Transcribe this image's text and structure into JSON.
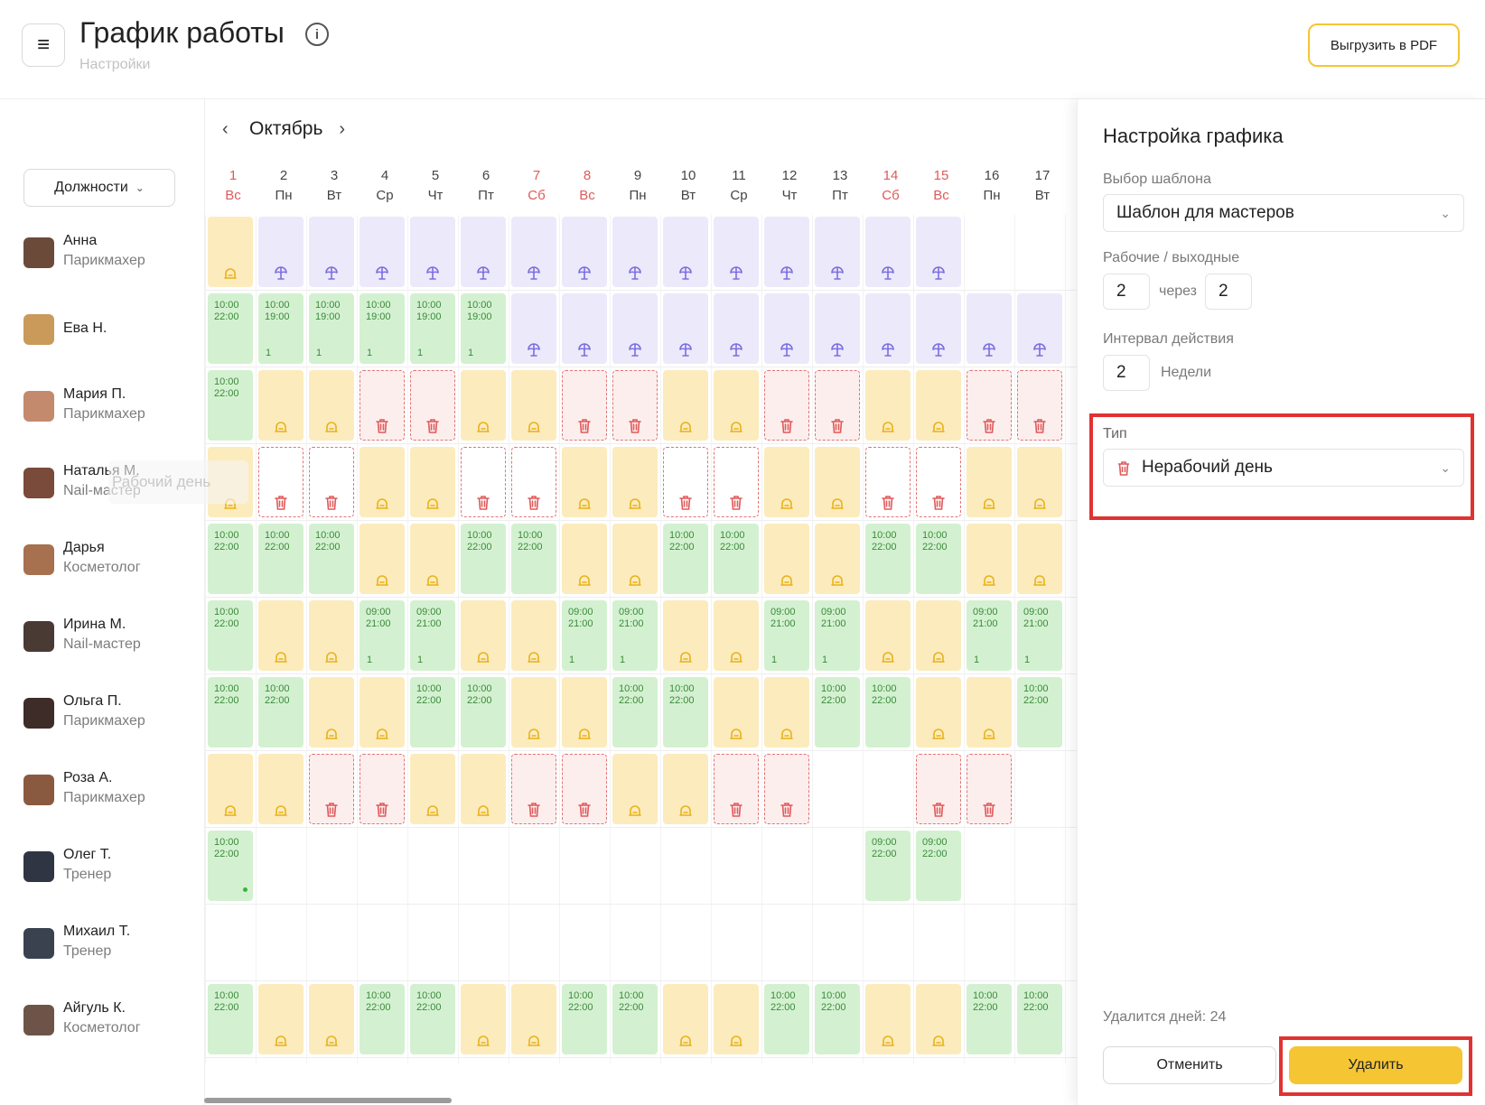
{
  "header": {
    "title": "График работы",
    "subtitle": "Настройки",
    "pdf_button": "Выгрузить в PDF"
  },
  "filters": {
    "positions_label": "Должности"
  },
  "calendar": {
    "month": "Октябрь",
    "days": [
      {
        "num": "1",
        "dow": "Вс",
        "weekend": true
      },
      {
        "num": "2",
        "dow": "Пн",
        "weekend": false
      },
      {
        "num": "3",
        "dow": "Вт",
        "weekend": false
      },
      {
        "num": "4",
        "dow": "Ср",
        "weekend": false
      },
      {
        "num": "5",
        "dow": "Чт",
        "weekend": false
      },
      {
        "num": "6",
        "dow": "Пт",
        "weekend": false
      },
      {
        "num": "7",
        "dow": "Сб",
        "weekend": true
      },
      {
        "num": "8",
        "dow": "Вс",
        "weekend": true
      },
      {
        "num": "9",
        "dow": "Пн",
        "weekend": false
      },
      {
        "num": "10",
        "dow": "Вт",
        "weekend": false
      },
      {
        "num": "11",
        "dow": "Ср",
        "weekend": false
      },
      {
        "num": "12",
        "dow": "Чт",
        "weekend": false
      },
      {
        "num": "13",
        "dow": "Пт",
        "weekend": false
      },
      {
        "num": "14",
        "dow": "Сб",
        "weekend": true
      },
      {
        "num": "15",
        "dow": "Вс",
        "weekend": true
      },
      {
        "num": "16",
        "dow": "Пн",
        "weekend": false
      },
      {
        "num": "17",
        "dow": "Вт",
        "weekend": false
      }
    ],
    "ghost_label": "Рабочий день"
  },
  "employees": [
    {
      "name": "Анна",
      "role": "Парикмахер",
      "avatar_color": "#6b4a3a",
      "cells": [
        "H",
        "V",
        "V",
        "V",
        "V",
        "V",
        "V",
        "V",
        "V",
        "V",
        "V",
        "V",
        "V",
        "V",
        "V",
        "E",
        "E"
      ]
    },
    {
      "name": "Ева Н.",
      "role": "",
      "avatar_color": "#c99a5a",
      "cells": [
        "W:10:00|22:00",
        "W:10:00|19:00|1",
        "W:10:00|19:00|1",
        "W:10:00|19:00|1",
        "W:10:00|19:00|1",
        "W:10:00|19:00|1",
        "V",
        "V",
        "V",
        "V",
        "V",
        "V",
        "V",
        "V",
        "V",
        "V",
        "V"
      ]
    },
    {
      "name": "Мария П.",
      "role": "Парикмахер",
      "avatar_color": "#c48a6e",
      "cells": [
        "W:10:00|22:00",
        "H",
        "H",
        "D",
        "D",
        "H",
        "H",
        "D",
        "D",
        "H",
        "H",
        "D",
        "D",
        "H",
        "H",
        "D",
        "D"
      ]
    },
    {
      "name": "Наталья М.",
      "role": "Nail-мастер",
      "avatar_color": "#7a4a3a",
      "cells": [
        "H",
        "DW",
        "DW",
        "H",
        "H",
        "DW",
        "DW",
        "H",
        "H",
        "DW",
        "DW",
        "H",
        "H",
        "DW",
        "DW",
        "H",
        "H"
      ]
    },
    {
      "name": "Дарья",
      "role": "Косметолог",
      "avatar_color": "#a7704f",
      "cells": [
        "W:10:00|22:00",
        "W:10:00|22:00",
        "W:10:00|22:00",
        "H",
        "H",
        "W:10:00|22:00",
        "W:10:00|22:00",
        "H",
        "H",
        "W:10:00|22:00",
        "W:10:00|22:00",
        "H",
        "H",
        "W:10:00|22:00",
        "W:10:00|22:00",
        "H",
        "H"
      ]
    },
    {
      "name": "Ирина М.",
      "role": "Nail-мастер",
      "avatar_color": "#4a3a34",
      "cells": [
        "W:10:00|22:00",
        "H",
        "H",
        "W:09:00|21:00|1",
        "W:09:00|21:00|1",
        "H",
        "H",
        "W:09:00|21:00|1",
        "W:09:00|21:00|1",
        "H",
        "H",
        "W:09:00|21:00|1",
        "W:09:00|21:00|1",
        "H",
        "H",
        "W:09:00|21:00|1",
        "W:09:00|21:00|1"
      ]
    },
    {
      "name": "Ольга П.",
      "role": "Парикмахер",
      "avatar_color": "#3d2c28",
      "cells": [
        "W:10:00|22:00",
        "W:10:00|22:00",
        "H",
        "H",
        "W:10:00|22:00",
        "W:10:00|22:00",
        "H",
        "H",
        "W:10:00|22:00",
        "W:10:00|22:00",
        "H",
        "H",
        "W:10:00|22:00",
        "W:10:00|22:00",
        "H",
        "H",
        "W:10:00|22:00"
      ]
    },
    {
      "name": "Роза А.",
      "role": "Парикмахер",
      "avatar_color": "#8a5a40",
      "cells": [
        "H",
        "H",
        "D",
        "D",
        "H",
        "H",
        "D",
        "D",
        "H",
        "H",
        "D",
        "D",
        "E",
        "E",
        "D",
        "D",
        "E"
      ]
    },
    {
      "name": "Олег Т.",
      "role": "Тренер",
      "avatar_color": "#2f3542",
      "cells": [
        "W:10:00|22:00|dot",
        "E",
        "E",
        "E",
        "E",
        "E",
        "E",
        "E",
        "E",
        "E",
        "E",
        "E",
        "E",
        "W:09:00|22:00",
        "W:09:00|22:00",
        "E",
        "E"
      ]
    },
    {
      "name": "Михаил Т.",
      "role": "Тренер",
      "avatar_color": "#3a4250",
      "cells": [
        "E",
        "E",
        "E",
        "E",
        "E",
        "E",
        "E",
        "E",
        "E",
        "E",
        "E",
        "E",
        "E",
        "E",
        "E",
        "E",
        "E"
      ]
    },
    {
      "name": "Айгуль К.",
      "role": "Косметолог",
      "avatar_color": "#6e5448",
      "cells": [
        "W:10:00|22:00",
        "H",
        "H",
        "W:10:00|22:00",
        "W:10:00|22:00",
        "H",
        "H",
        "W:10:00|22:00",
        "W:10:00|22:00",
        "H",
        "H",
        "W:10:00|22:00",
        "W:10:00|22:00",
        "H",
        "H",
        "W:10:00|22:00",
        "W:10:00|22:00"
      ]
    }
  ],
  "panel": {
    "title": "Настройка графика",
    "template_label": "Выбор шаблона",
    "template_value": "Шаблон для мастеров",
    "workoff_label": "Рабочие / выходные",
    "work_days": "2",
    "through_label": "через",
    "off_days": "2",
    "interval_label": "Интервал действия",
    "interval_value": "2",
    "interval_unit": "Недели",
    "type_label": "Тип",
    "type_value": "Нерабочий день",
    "delete_info": "Удалится дней: 24",
    "cancel_button": "Отменить",
    "delete_button": "Удалить"
  },
  "colors": {
    "accent": "#f5c533",
    "highlight": "#e13232",
    "work": "#d3f1d0",
    "home": "#fcebbd",
    "vacation": "#ece9fa",
    "delete": "#fdeeee"
  }
}
